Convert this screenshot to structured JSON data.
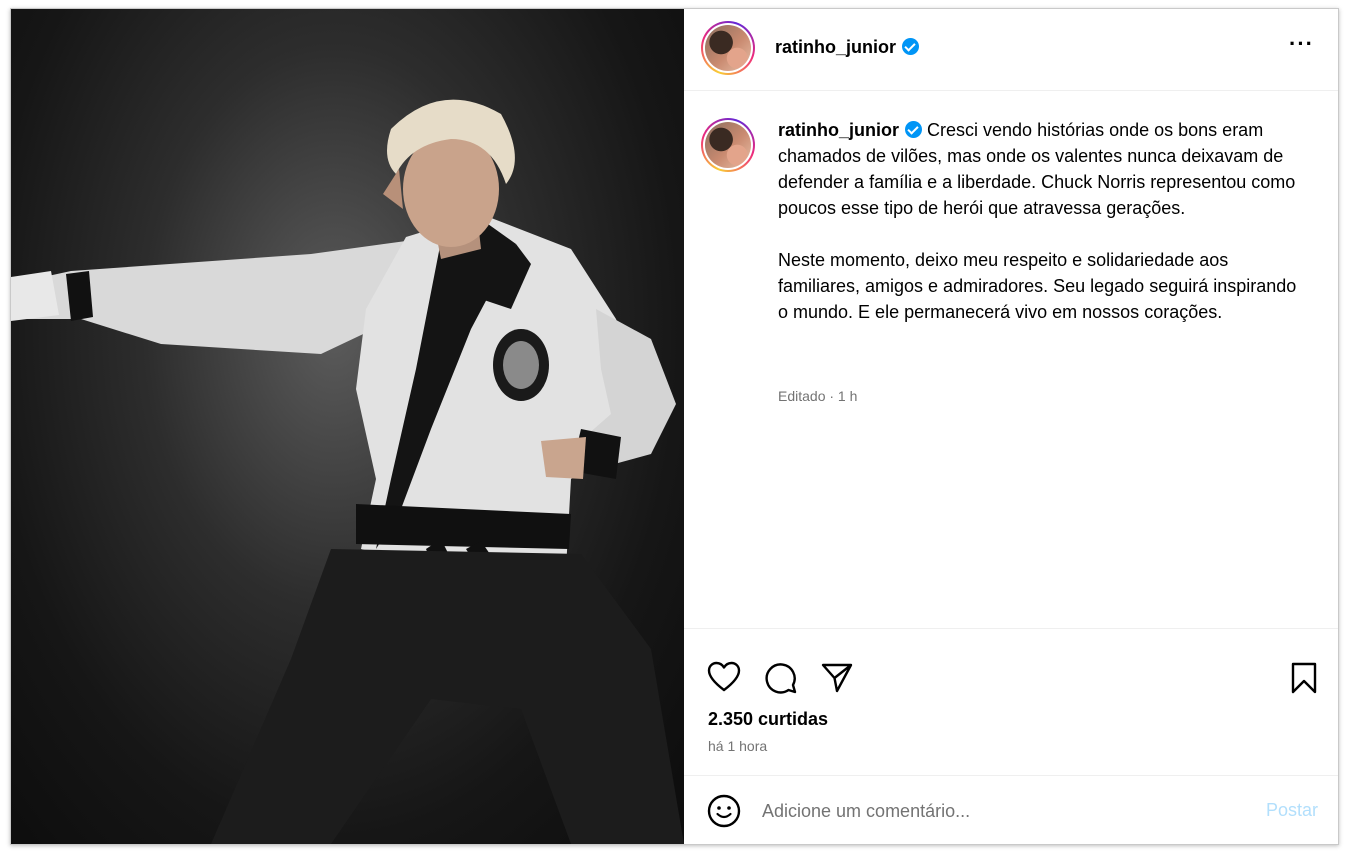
{
  "post": {
    "username": "ratinho_junior",
    "verified": true,
    "caption_paragraphs": [
      "Cresci vendo histórias onde os bons eram chamados de vilões, mas onde os valentes nunca deixavam de defender a família e a liberdade. Chuck Norris representou como poucos esse tipo de herói que atravessa gerações.",
      "Neste momento, deixo meu respeito e solidariedade aos familiares, amigos e admiradores. Seu legado seguirá inspirando o mundo. E ele permanecerá vivo em nossos corações."
    ],
    "edited_label": "Editado · 1 h",
    "likes_label": "2.350 curtidas",
    "time_label": "há 1 hora"
  },
  "comment": {
    "placeholder": "Adicione um comentário...",
    "post_label": "Postar"
  },
  "icons": {
    "more": "more-options-icon",
    "like": "heart-icon",
    "comment": "comment-icon",
    "share": "share-icon",
    "save": "bookmark-icon",
    "emoji": "emoji-icon",
    "verified": "verified-badge-icon"
  },
  "colors": {
    "verified": "#0095f6",
    "post_button": "#b2dffc",
    "secondary_text": "#737373"
  }
}
